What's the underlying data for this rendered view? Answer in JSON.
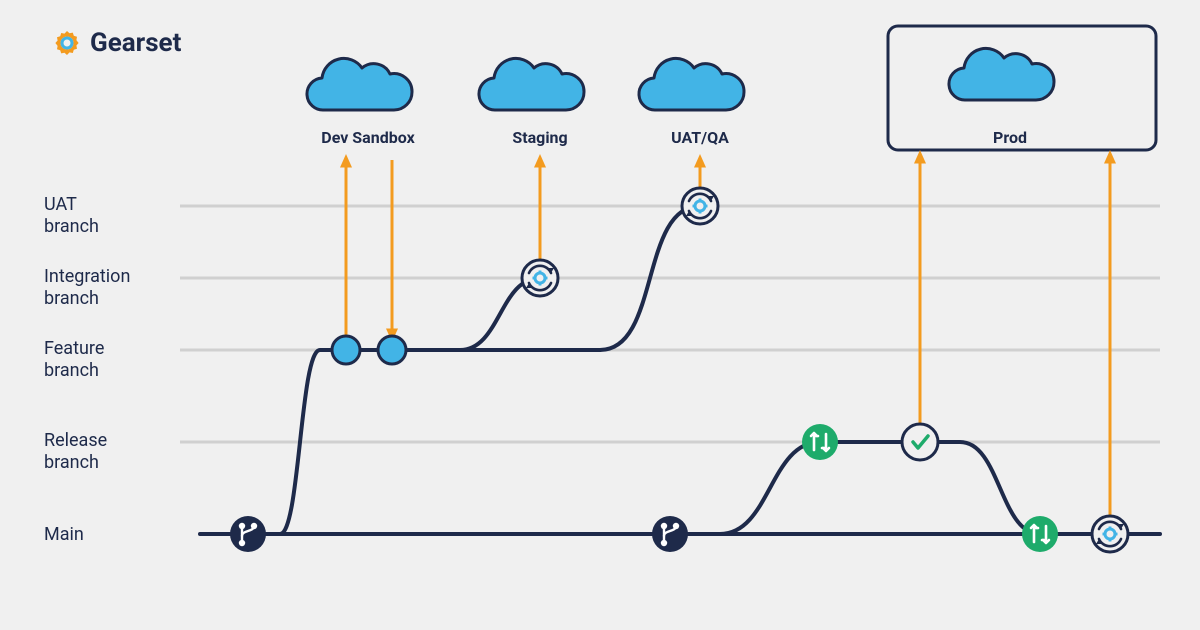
{
  "logo": {
    "text": "Gearset"
  },
  "environments": {
    "dev": "Dev Sandbox",
    "staging": "Staging",
    "uat": "UAT/QA",
    "prod": "Prod"
  },
  "branches": {
    "uat": "UAT\nbranch",
    "integration": "Integration\nbranch",
    "feature": "Feature\nbranch",
    "release": "Release\nbranch",
    "main": "Main"
  },
  "colors": {
    "navy": "#1e2a4a",
    "blue": "#42b4e6",
    "green": "#1eab6b",
    "orange": "#f39b1f",
    "grid": "#d0d0d0",
    "bg": "#f0f0f0"
  }
}
